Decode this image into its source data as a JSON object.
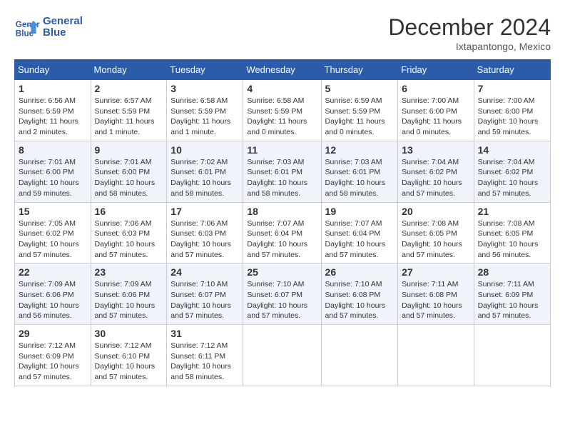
{
  "header": {
    "logo_line1": "General",
    "logo_line2": "Blue",
    "month": "December 2024",
    "location": "Ixtapantongo, Mexico"
  },
  "weekdays": [
    "Sunday",
    "Monday",
    "Tuesday",
    "Wednesday",
    "Thursday",
    "Friday",
    "Saturday"
  ],
  "weeks": [
    [
      {
        "day": "1",
        "sunrise": "6:56 AM",
        "sunset": "5:59 PM",
        "daylight": "11 hours and 2 minutes."
      },
      {
        "day": "2",
        "sunrise": "6:57 AM",
        "sunset": "5:59 PM",
        "daylight": "11 hours and 1 minute."
      },
      {
        "day": "3",
        "sunrise": "6:58 AM",
        "sunset": "5:59 PM",
        "daylight": "11 hours and 1 minute."
      },
      {
        "day": "4",
        "sunrise": "6:58 AM",
        "sunset": "5:59 PM",
        "daylight": "11 hours and 0 minutes."
      },
      {
        "day": "5",
        "sunrise": "6:59 AM",
        "sunset": "5:59 PM",
        "daylight": "11 hours and 0 minutes."
      },
      {
        "day": "6",
        "sunrise": "7:00 AM",
        "sunset": "6:00 PM",
        "daylight": "11 hours and 0 minutes."
      },
      {
        "day": "7",
        "sunrise": "7:00 AM",
        "sunset": "6:00 PM",
        "daylight": "10 hours and 59 minutes."
      }
    ],
    [
      {
        "day": "8",
        "sunrise": "7:01 AM",
        "sunset": "6:00 PM",
        "daylight": "10 hours and 59 minutes."
      },
      {
        "day": "9",
        "sunrise": "7:01 AM",
        "sunset": "6:00 PM",
        "daylight": "10 hours and 58 minutes."
      },
      {
        "day": "10",
        "sunrise": "7:02 AM",
        "sunset": "6:01 PM",
        "daylight": "10 hours and 58 minutes."
      },
      {
        "day": "11",
        "sunrise": "7:03 AM",
        "sunset": "6:01 PM",
        "daylight": "10 hours and 58 minutes."
      },
      {
        "day": "12",
        "sunrise": "7:03 AM",
        "sunset": "6:01 PM",
        "daylight": "10 hours and 58 minutes."
      },
      {
        "day": "13",
        "sunrise": "7:04 AM",
        "sunset": "6:02 PM",
        "daylight": "10 hours and 57 minutes."
      },
      {
        "day": "14",
        "sunrise": "7:04 AM",
        "sunset": "6:02 PM",
        "daylight": "10 hours and 57 minutes."
      }
    ],
    [
      {
        "day": "15",
        "sunrise": "7:05 AM",
        "sunset": "6:02 PM",
        "daylight": "10 hours and 57 minutes."
      },
      {
        "day": "16",
        "sunrise": "7:06 AM",
        "sunset": "6:03 PM",
        "daylight": "10 hours and 57 minutes."
      },
      {
        "day": "17",
        "sunrise": "7:06 AM",
        "sunset": "6:03 PM",
        "daylight": "10 hours and 57 minutes."
      },
      {
        "day": "18",
        "sunrise": "7:07 AM",
        "sunset": "6:04 PM",
        "daylight": "10 hours and 57 minutes."
      },
      {
        "day": "19",
        "sunrise": "7:07 AM",
        "sunset": "6:04 PM",
        "daylight": "10 hours and 57 minutes."
      },
      {
        "day": "20",
        "sunrise": "7:08 AM",
        "sunset": "6:05 PM",
        "daylight": "10 hours and 57 minutes."
      },
      {
        "day": "21",
        "sunrise": "7:08 AM",
        "sunset": "6:05 PM",
        "daylight": "10 hours and 56 minutes."
      }
    ],
    [
      {
        "day": "22",
        "sunrise": "7:09 AM",
        "sunset": "6:06 PM",
        "daylight": "10 hours and 56 minutes."
      },
      {
        "day": "23",
        "sunrise": "7:09 AM",
        "sunset": "6:06 PM",
        "daylight": "10 hours and 57 minutes."
      },
      {
        "day": "24",
        "sunrise": "7:10 AM",
        "sunset": "6:07 PM",
        "daylight": "10 hours and 57 minutes."
      },
      {
        "day": "25",
        "sunrise": "7:10 AM",
        "sunset": "6:07 PM",
        "daylight": "10 hours and 57 minutes."
      },
      {
        "day": "26",
        "sunrise": "7:10 AM",
        "sunset": "6:08 PM",
        "daylight": "10 hours and 57 minutes."
      },
      {
        "day": "27",
        "sunrise": "7:11 AM",
        "sunset": "6:08 PM",
        "daylight": "10 hours and 57 minutes."
      },
      {
        "day": "28",
        "sunrise": "7:11 AM",
        "sunset": "6:09 PM",
        "daylight": "10 hours and 57 minutes."
      }
    ],
    [
      {
        "day": "29",
        "sunrise": "7:12 AM",
        "sunset": "6:09 PM",
        "daylight": "10 hours and 57 minutes."
      },
      {
        "day": "30",
        "sunrise": "7:12 AM",
        "sunset": "6:10 PM",
        "daylight": "10 hours and 57 minutes."
      },
      {
        "day": "31",
        "sunrise": "7:12 AM",
        "sunset": "6:11 PM",
        "daylight": "10 hours and 58 minutes."
      },
      null,
      null,
      null,
      null
    ]
  ]
}
